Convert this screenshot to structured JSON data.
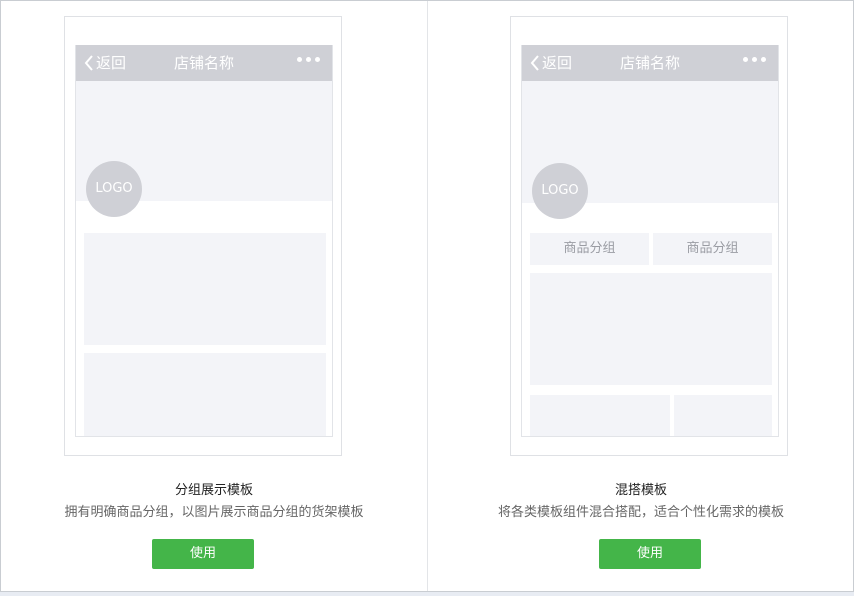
{
  "templates": [
    {
      "title": "分组展示模板",
      "description": "拥有明确商品分组，以图片展示商品分组的货架模板",
      "button_label": "使用",
      "preview": {
        "back_label": "返回",
        "shop_name": "店铺名称",
        "logo_text": "LOGO",
        "more_icon": "ellipsis-icon"
      }
    },
    {
      "title": "混搭模板",
      "description": "将各类模板组件混合搭配，适合个性化需求的模板",
      "button_label": "使用",
      "preview": {
        "back_label": "返回",
        "shop_name": "店铺名称",
        "logo_text": "LOGO",
        "more_icon": "ellipsis-icon",
        "tabs": [
          "商品分组",
          "商品分组"
        ]
      }
    }
  ],
  "colors": {
    "accent": "#44b549",
    "navbar": "#cfd0d6",
    "placeholder": "#f3f4f8"
  }
}
